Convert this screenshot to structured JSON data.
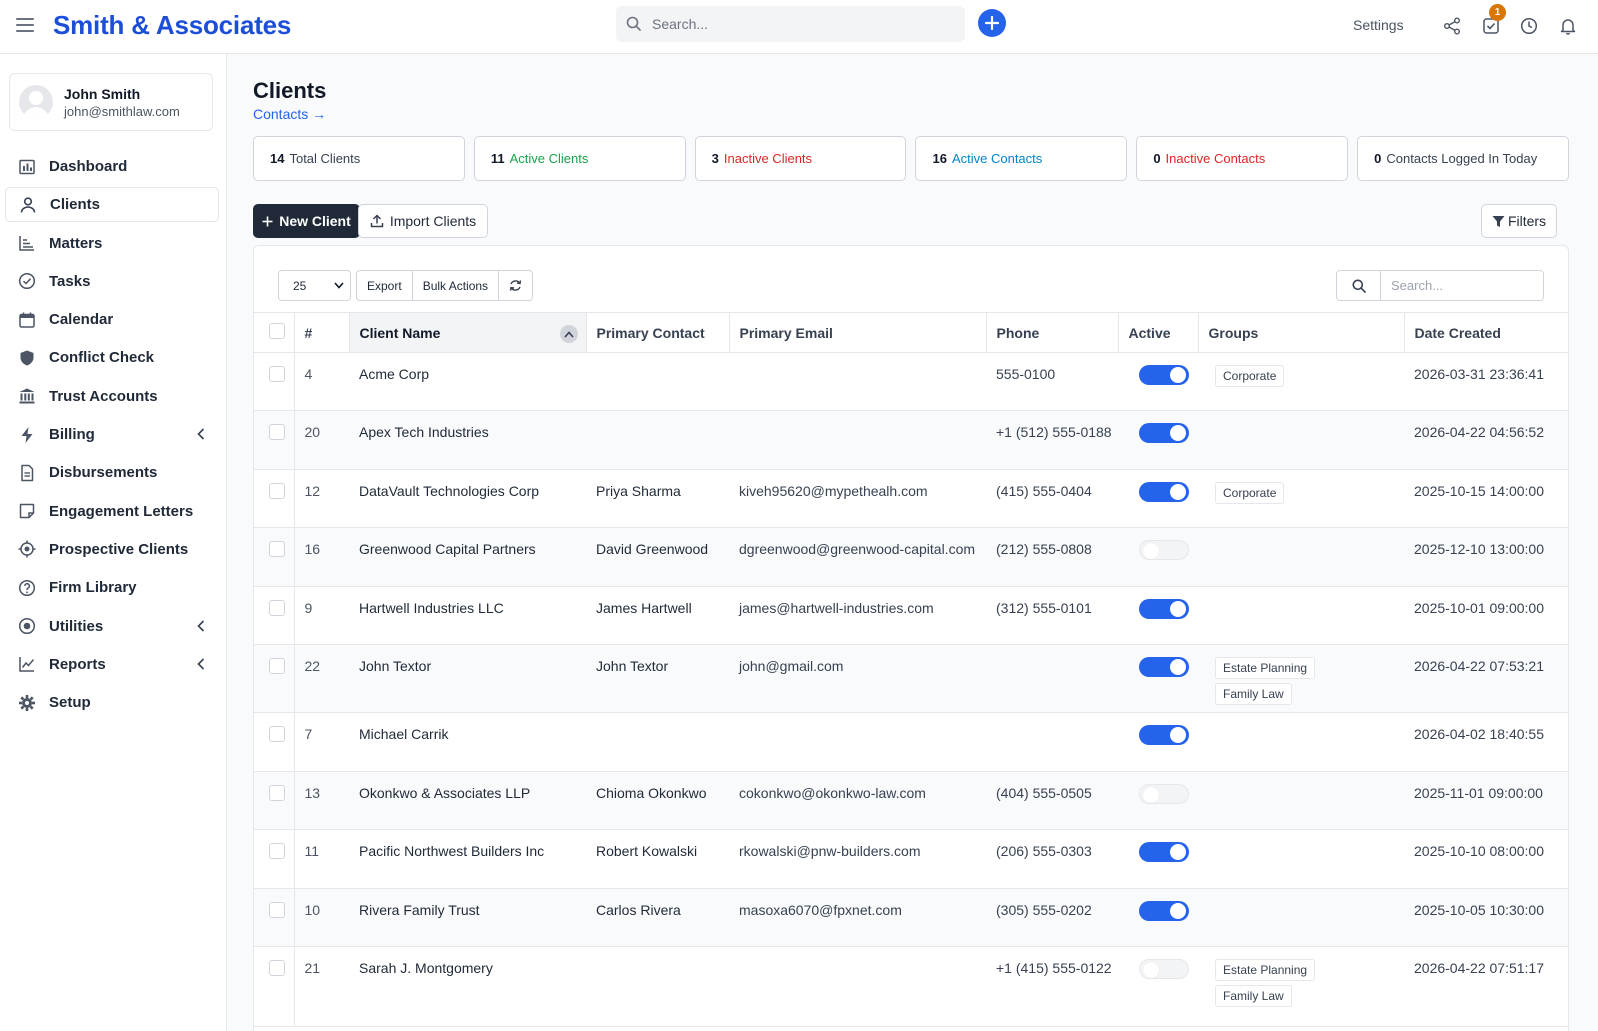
{
  "app": {
    "brand": "Smith & Associates",
    "search_placeholder": "Search...",
    "settings_label": "Settings",
    "notification_count": "1",
    "accent_color": "#2563eb"
  },
  "user": {
    "name": "John Smith",
    "email": "john@smithlaw.com"
  },
  "nav": [
    {
      "label": "Dashboard",
      "icon": "dashboard-icon"
    },
    {
      "label": "Clients",
      "icon": "user-icon",
      "active": true
    },
    {
      "label": "Matters",
      "icon": "chart-icon"
    },
    {
      "label": "Tasks",
      "icon": "check-circle-icon"
    },
    {
      "label": "Calendar",
      "icon": "calendar-icon"
    },
    {
      "label": "Conflict Check",
      "icon": "shield-icon"
    },
    {
      "label": "Trust Accounts",
      "icon": "bank-icon"
    },
    {
      "label": "Billing",
      "icon": "bolt-icon",
      "expandable": true
    },
    {
      "label": "Disbursements",
      "icon": "document-icon"
    },
    {
      "label": "Engagement Letters",
      "icon": "note-icon"
    },
    {
      "label": "Prospective Clients",
      "icon": "crosshair-icon"
    },
    {
      "label": "Firm Library",
      "icon": "help-circle-icon"
    },
    {
      "label": "Utilities",
      "icon": "radio-icon",
      "expandable": true
    },
    {
      "label": "Reports",
      "icon": "line-chart-icon",
      "expandable": true
    },
    {
      "label": "Setup",
      "icon": "gear-icon"
    }
  ],
  "page": {
    "title": "Clients",
    "contacts_link": "Contacts →",
    "new_client": "New Client",
    "import_clients": "Import Clients",
    "filters": "Filters"
  },
  "stats": [
    {
      "count": "14",
      "label": "Total Clients",
      "color": "gray"
    },
    {
      "count": "11",
      "label": "Active Clients",
      "color": "green"
    },
    {
      "count": "3",
      "label": "Inactive Clients",
      "color": "red"
    },
    {
      "count": "16",
      "label": "Active Contacts",
      "color": "blue"
    },
    {
      "count": "0",
      "label": "Inactive Contacts",
      "color": "red"
    },
    {
      "count": "0",
      "label": "Contacts Logged In Today",
      "color": "gray"
    }
  ],
  "toolbar": {
    "per_page": "25",
    "export": "Export",
    "bulk_actions": "Bulk Actions",
    "search_placeholder": "Search..."
  },
  "columns": [
    "#",
    "Client Name",
    "Primary Contact",
    "Primary Email",
    "Phone",
    "Active",
    "Groups",
    "Date Created"
  ],
  "rows": [
    {
      "id": "4",
      "name": "Acme Corp",
      "contact": "",
      "email": "",
      "phone": "555-0100",
      "active": true,
      "groups": [
        "Corporate"
      ],
      "created": "2026-03-31 23:36:41"
    },
    {
      "id": "20",
      "name": "Apex Tech Industries",
      "contact": "",
      "email": "",
      "phone": "+1 (512) 555-0188",
      "active": true,
      "groups": [],
      "created": "2026-04-22 04:56:52"
    },
    {
      "id": "12",
      "name": "DataVault Technologies Corp",
      "contact": "Priya Sharma",
      "email": "kiveh95620@mypethealh.com",
      "phone": "(415) 555-0404",
      "active": true,
      "groups": [
        "Corporate"
      ],
      "created": "2025-10-15 14:00:00"
    },
    {
      "id": "16",
      "name": "Greenwood Capital Partners",
      "contact": "David Greenwood",
      "email": "dgreenwood@greenwood-capital.com",
      "phone": "(212) 555-0808",
      "active": false,
      "groups": [],
      "created": "2025-12-10 13:00:00"
    },
    {
      "id": "9",
      "name": "Hartwell Industries LLC",
      "contact": "James Hartwell",
      "email": "james@hartwell-industries.com",
      "phone": "(312) 555-0101",
      "active": true,
      "groups": [],
      "created": "2025-10-01 09:00:00"
    },
    {
      "id": "22",
      "name": "John Textor",
      "contact": "John Textor",
      "email": "john@gmail.com",
      "phone": "",
      "active": true,
      "groups": [
        "Estate Planning",
        "Family Law"
      ],
      "created": "2026-04-22 07:53:21"
    },
    {
      "id": "7",
      "name": "Michael Carrik",
      "contact": "",
      "email": "",
      "phone": "",
      "active": true,
      "groups": [],
      "created": "2026-04-02 18:40:55"
    },
    {
      "id": "13",
      "name": "Okonkwo & Associates LLP",
      "contact": "Chioma Okonkwo",
      "email": "cokonkwo@okonkwo-law.com",
      "phone": "(404) 555-0505",
      "active": false,
      "groups": [],
      "created": "2025-11-01 09:00:00"
    },
    {
      "id": "11",
      "name": "Pacific Northwest Builders Inc",
      "contact": "Robert Kowalski",
      "email": "rkowalski@pnw-builders.com",
      "phone": "(206) 555-0303",
      "active": true,
      "groups": [],
      "created": "2025-10-10 08:00:00"
    },
    {
      "id": "10",
      "name": "Rivera Family Trust",
      "contact": "Carlos Rivera",
      "email": "masoxa6070@fpxnet.com",
      "phone": "(305) 555-0202",
      "active": true,
      "groups": [],
      "created": "2025-10-05 10:30:00"
    },
    {
      "id": "21",
      "name": "Sarah J. Montgomery",
      "contact": "",
      "email": "",
      "phone": "+1 (415) 555-0122",
      "active": false,
      "groups": [
        "Estate Planning",
        "Family Law"
      ],
      "created": "2026-04-22 07:51:17"
    }
  ]
}
